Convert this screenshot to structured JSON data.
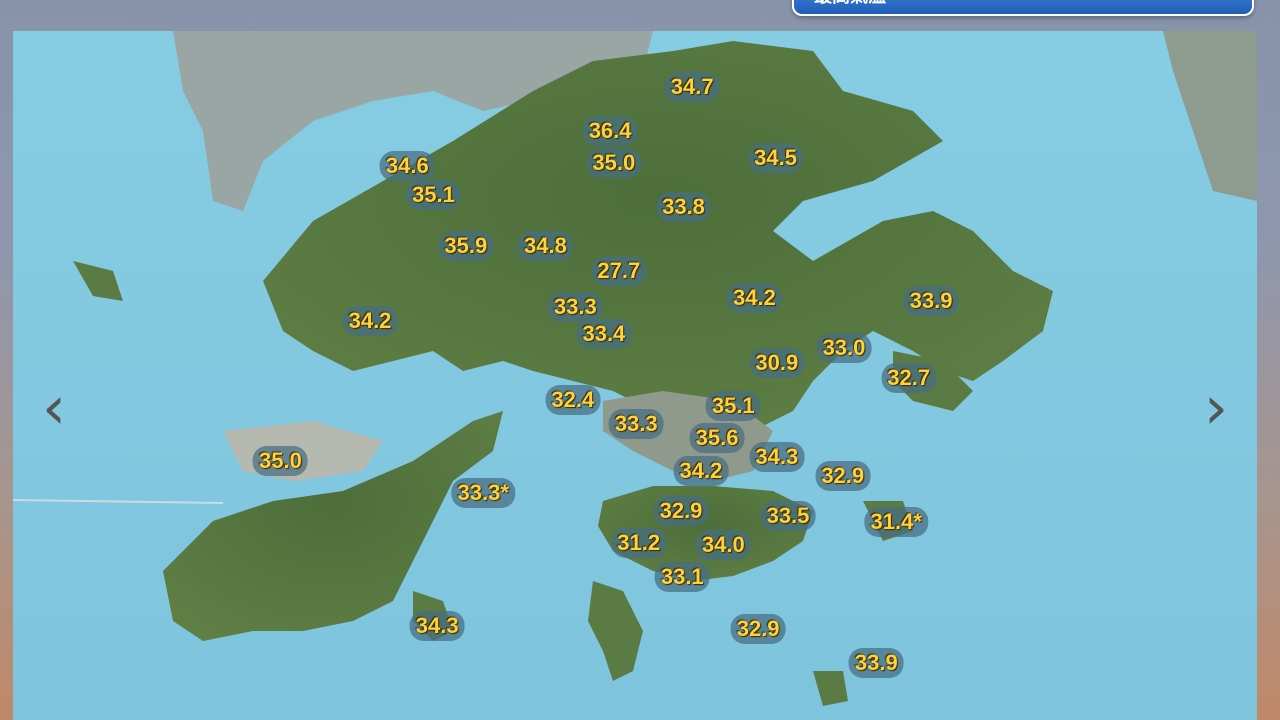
{
  "dropdown": {
    "selected": "最高氣溫",
    "arrow_icon": "chevron-down-icon"
  },
  "nav": {
    "prev_icon": "chevron-left-icon",
    "next_icon": "chevron-right-icon",
    "prev_glyph": "‹",
    "next_glyph": "›"
  },
  "readings": [
    {
      "value": "34.7",
      "lon": 0.546,
      "lat": 0.081
    },
    {
      "value": "36.4",
      "lon": 0.48,
      "lat": 0.145
    },
    {
      "value": "34.6",
      "lon": 0.317,
      "lat": 0.196
    },
    {
      "value": "35.0",
      "lon": 0.483,
      "lat": 0.191
    },
    {
      "value": "34.5",
      "lon": 0.613,
      "lat": 0.185
    },
    {
      "value": "35.1",
      "lon": 0.338,
      "lat": 0.238
    },
    {
      "value": "33.8",
      "lon": 0.539,
      "lat": 0.256
    },
    {
      "value": "35.9",
      "lon": 0.364,
      "lat": 0.312
    },
    {
      "value": "34.8",
      "lon": 0.428,
      "lat": 0.312
    },
    {
      "value": "27.7",
      "lon": 0.487,
      "lat": 0.349
    },
    {
      "value": "33.3",
      "lon": 0.452,
      "lat": 0.401
    },
    {
      "value": "34.2",
      "lon": 0.596,
      "lat": 0.388
    },
    {
      "value": "33.9",
      "lon": 0.738,
      "lat": 0.392
    },
    {
      "value": "34.2",
      "lon": 0.287,
      "lat": 0.421
    },
    {
      "value": "33.4",
      "lon": 0.475,
      "lat": 0.44
    },
    {
      "value": "33.0",
      "lon": 0.668,
      "lat": 0.46
    },
    {
      "value": "30.9",
      "lon": 0.614,
      "lat": 0.482
    },
    {
      "value": "32.7",
      "lon": 0.72,
      "lat": 0.504
    },
    {
      "value": "32.4",
      "lon": 0.45,
      "lat": 0.536
    },
    {
      "value": "35.1",
      "lon": 0.579,
      "lat": 0.544
    },
    {
      "value": "33.3",
      "lon": 0.501,
      "lat": 0.57
    },
    {
      "value": "35.6",
      "lon": 0.566,
      "lat": 0.59
    },
    {
      "value": "35.0",
      "lon": 0.215,
      "lat": 0.624
    },
    {
      "value": "34.3",
      "lon": 0.614,
      "lat": 0.619
    },
    {
      "value": "34.2",
      "lon": 0.553,
      "lat": 0.638
    },
    {
      "value": "32.9",
      "lon": 0.667,
      "lat": 0.646
    },
    {
      "value": "33.3*",
      "lon": 0.378,
      "lat": 0.671
    },
    {
      "value": "32.9",
      "lon": 0.537,
      "lat": 0.697
    },
    {
      "value": "33.5",
      "lon": 0.623,
      "lat": 0.704
    },
    {
      "value": "31.4*",
      "lon": 0.71,
      "lat": 0.712
    },
    {
      "value": "31.2",
      "lon": 0.503,
      "lat": 0.743
    },
    {
      "value": "34.0",
      "lon": 0.571,
      "lat": 0.746
    },
    {
      "value": "33.1",
      "lon": 0.538,
      "lat": 0.792
    },
    {
      "value": "34.3",
      "lon": 0.341,
      "lat": 0.864
    },
    {
      "value": "32.9",
      "lon": 0.599,
      "lat": 0.868
    },
    {
      "value": "33.9",
      "lon": 0.694,
      "lat": 0.917
    }
  ]
}
